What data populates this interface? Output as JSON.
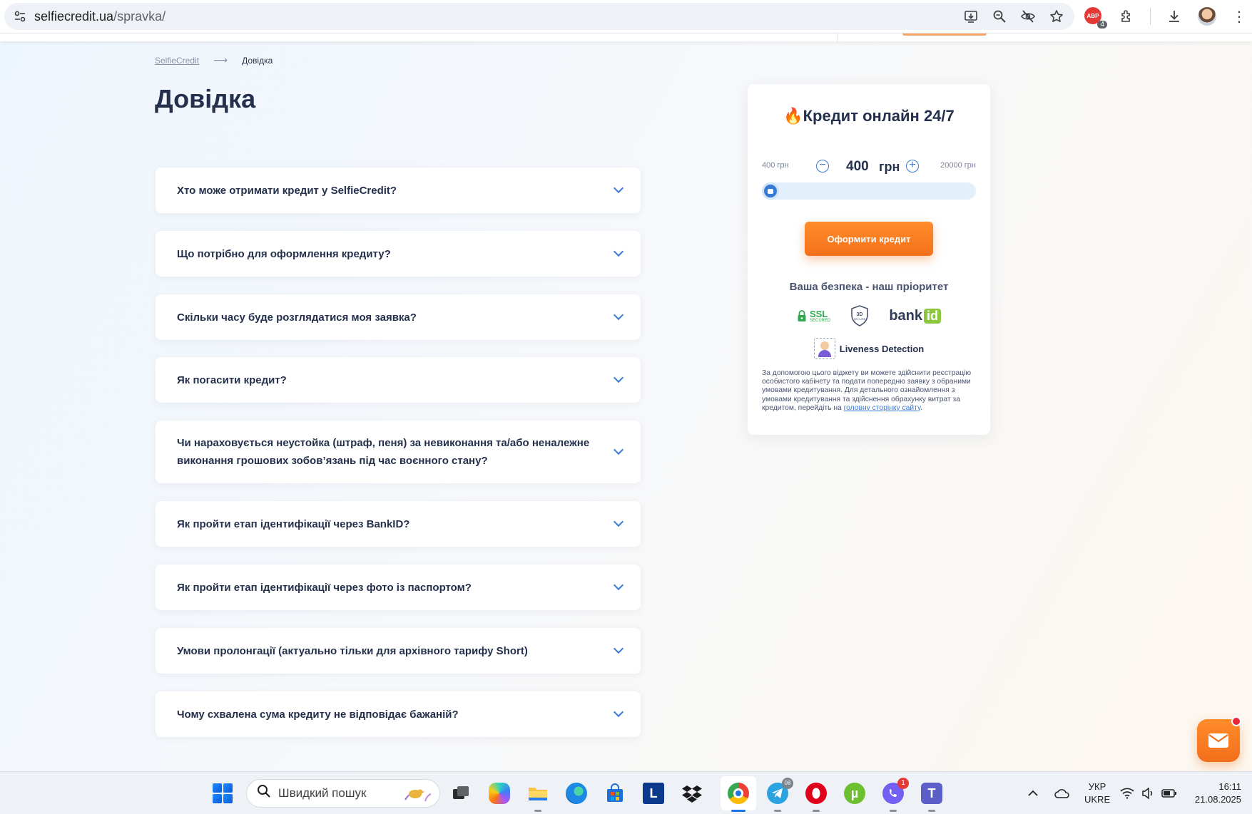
{
  "browser": {
    "url_host": "selfiecredit.ua",
    "url_path": "/spravka/",
    "extension_badge_text": "ABP",
    "extension_badge_count": "4"
  },
  "breadcrumb": {
    "home": "SelfieCredit",
    "arrow": "⟶",
    "current": "Довідка"
  },
  "page": {
    "title": "Довідка"
  },
  "faq": [
    {
      "question": "Хто може отримати кредит у SelfieCredit?"
    },
    {
      "question": "Що потрібно для оформлення кредиту?"
    },
    {
      "question": "Скільки часу буде розглядатися моя заявка?"
    },
    {
      "question": "Як погасити кредит?"
    },
    {
      "question": "Чи нараховується неустойка (штраф, пеня) за невиконання та/або неналежне виконання грошових зобов’язань під час воєнного стану?"
    },
    {
      "question": "Як пройти етап ідентифікації через BankID?"
    },
    {
      "question": "Як пройти етап ідентифікації через фото із паспортом?"
    },
    {
      "question": "Умови пролонгації (актуально тільки для архівного тарифу Short)"
    },
    {
      "question": "Чому схвалена сума кредиту не відповідає бажаній?"
    }
  ],
  "widget": {
    "title_icon": "🔥",
    "title": "Кредит онлайн 24/7",
    "min_label": "400 грн",
    "max_label": "20000 грн",
    "amount": "400",
    "currency": "грн",
    "slider": {
      "min": 400,
      "max": 20000,
      "value": 400
    },
    "cta_label": "Оформити кредит",
    "security_title": "Ваша безпека - наш пріоритет",
    "ssl_label": "SSL",
    "ssl_sub": "SECURED",
    "secure_3d_label": "3D",
    "secure_3d_sub": "SECURE",
    "bankid_text": "bank",
    "bankid_id": "id",
    "liveness_label": "Liveness Detection",
    "disclaimer": "За допомогою цього віджету ви можете здійснити реєстрацію особистого кабінету та подати попередню заявку з обраними умовами кредитування. Для детального ознайомлення з умовами кредитування та здійснення обрахунку витрат за кредитом, перейдіть на ",
    "disclaimer_link": "головну сторінку сайту",
    "disclaimer_end": "."
  },
  "taskbar": {
    "search_placeholder": "Швидкий пошук",
    "telegram_badge": "08",
    "viber_badge": "1",
    "language_line1": "УКР",
    "language_line2": "UKRE",
    "time": "16:11",
    "date": "21.08.2025"
  },
  "colors": {
    "accent_orange": "#f4701b",
    "accent_blue": "#3a7bd5",
    "title_dark": "#25304c",
    "bankid_green": "#8dc63f",
    "ssl_green": "#2fa84f"
  }
}
